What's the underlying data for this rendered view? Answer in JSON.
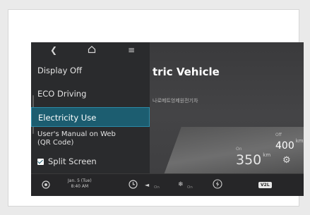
{
  "top_bar": {
    "back_icon": "chevron-left-icon",
    "home_icon": "home-icon",
    "menu_icon": "hamburger-menu-icon"
  },
  "menu": {
    "items": [
      {
        "label": "Display Off"
      },
      {
        "label": "ECO Driving"
      },
      {
        "label": "Electricity Use",
        "selected": true
      },
      {
        "label_line1": "User's Manual on Web",
        "label_line2": "(QR Code)"
      },
      {
        "label": "Split Screen",
        "checked": true
      }
    ]
  },
  "content": {
    "title": "tric Vehicle",
    "subtitle": "나로메트엉제원전기차",
    "range_main": {
      "label": "On",
      "value": "350",
      "unit": "km"
    },
    "range_alt": {
      "label": "Off",
      "value": "400",
      "unit": "km"
    }
  },
  "bottom_bar": {
    "clock_date": "Jan. 5 (Tue)",
    "clock_time": "8:40 AM",
    "seat_label": "On",
    "fan_label": "On",
    "v2l_label": "V2L"
  },
  "colors": {
    "selected_bg": "#1c5d70",
    "selected_border": "#2b8aa6",
    "screen_bg": "#2b2b2b"
  }
}
